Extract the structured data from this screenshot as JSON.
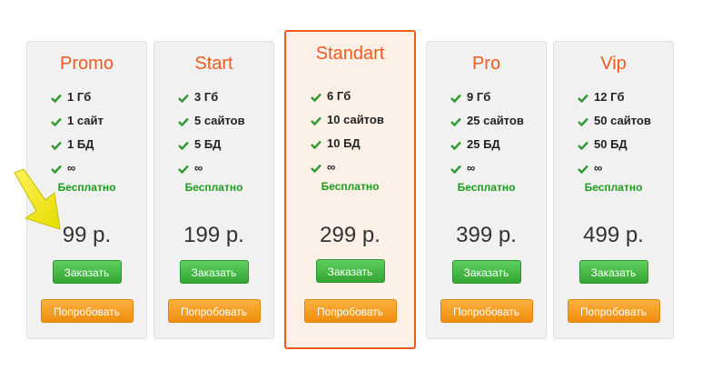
{
  "plans": [
    {
      "name": "Promo",
      "features": [
        "1 Гб",
        "1 сайт",
        "1 БД",
        "∞"
      ],
      "free_label": "Бесплатно",
      "price": "99 р.",
      "order_label": "Заказать",
      "try_label": "Попробовать",
      "featured": false
    },
    {
      "name": "Start",
      "features": [
        "3 Гб",
        "5 сайтов",
        "5 БД",
        "∞"
      ],
      "free_label": "Бесплатно",
      "price": "199 р.",
      "order_label": "Заказать",
      "try_label": "Попробовать",
      "featured": false
    },
    {
      "name": "Standart",
      "features": [
        "6 Гб",
        "10 сайтов",
        "10 БД",
        "∞"
      ],
      "free_label": "Бесплатно",
      "price": "299 р.",
      "order_label": "Заказать",
      "try_label": "Попробовать",
      "featured": true
    },
    {
      "name": "Pro",
      "features": [
        "9 Гб",
        "25 сайтов",
        "25 БД",
        "∞"
      ],
      "free_label": "Бесплатно",
      "price": "399 р.",
      "order_label": "Заказать",
      "try_label": "Попробовать",
      "featured": false
    },
    {
      "name": "Vip",
      "features": [
        "12 Гб",
        "50 сайтов",
        "50 БД",
        "∞"
      ],
      "free_label": "Бесплатно",
      "price": "499 р.",
      "order_label": "Заказать",
      "try_label": "Попробовать",
      "featured": false
    }
  ],
  "icons": {
    "feature": "check-icon",
    "annotation": "yellow-arrow-icon"
  },
  "colors": {
    "accent": "#f25a1e",
    "free_text": "#1b9e1b",
    "order_button": "#3cb13c",
    "try_button": "#f59a1e",
    "featured_bg": "#fdf0e6",
    "check": "#2f9a2f",
    "arrow": "#f4ec1a"
  }
}
